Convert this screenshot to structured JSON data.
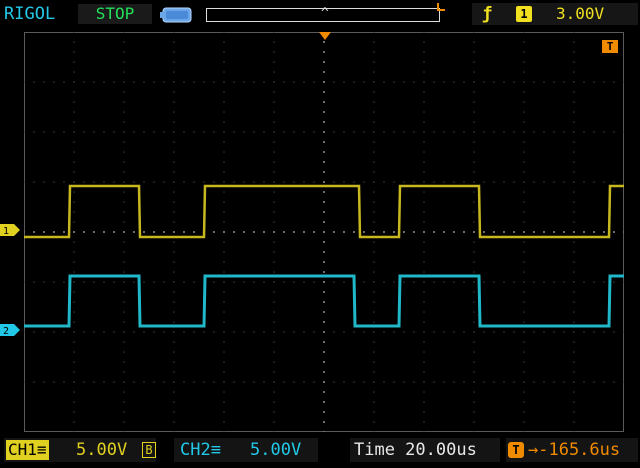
{
  "top_bar": {
    "brand": "RIGOL",
    "run_state": "STOP",
    "memory_caret": "^",
    "trigger": {
      "edge_symbol": "ƒ",
      "source": "1",
      "level": "3.00V"
    }
  },
  "markers": {
    "trigger_level_tag": "T",
    "ch1_tag": "1",
    "ch2_tag": "2"
  },
  "bottom_bar": {
    "ch1": {
      "name": "CH1",
      "coupling": "≡",
      "scale": "5.00V",
      "bw_limit": "B"
    },
    "ch2": {
      "name": "CH2",
      "coupling": "≡",
      "scale": "5.00V"
    },
    "time": "Time 20.00us",
    "trigger_offset": {
      "icon": "T",
      "value": "→-165.6us"
    }
  },
  "colors": {
    "ch1": "#c8b820",
    "ch2": "#20b8c8",
    "trigger": "#f08a00",
    "grid": "#3a3a3a"
  },
  "waveforms": {
    "ch1": {
      "low_volts": -0.7,
      "high_volts": 4.4,
      "edges_us": [
        [
          -116,
          "rise"
        ],
        [
          -88,
          "fall"
        ],
        [
          -62,
          "rise"
        ],
        [
          0,
          "fall"
        ],
        [
          16,
          "rise"
        ],
        [
          48,
          "fall"
        ],
        [
          100,
          "rise"
        ]
      ],
      "start_state": "low"
    },
    "ch2": {
      "low_volts": 0,
      "high_volts": 5.0,
      "edges_us": [
        [
          -116,
          "rise"
        ],
        [
          -88,
          "fall"
        ],
        [
          -62,
          "rise"
        ],
        [
          -2,
          "fall"
        ],
        [
          16,
          "rise"
        ],
        [
          48,
          "fall"
        ],
        [
          100,
          "rise"
        ]
      ],
      "start_state": "low"
    }
  }
}
